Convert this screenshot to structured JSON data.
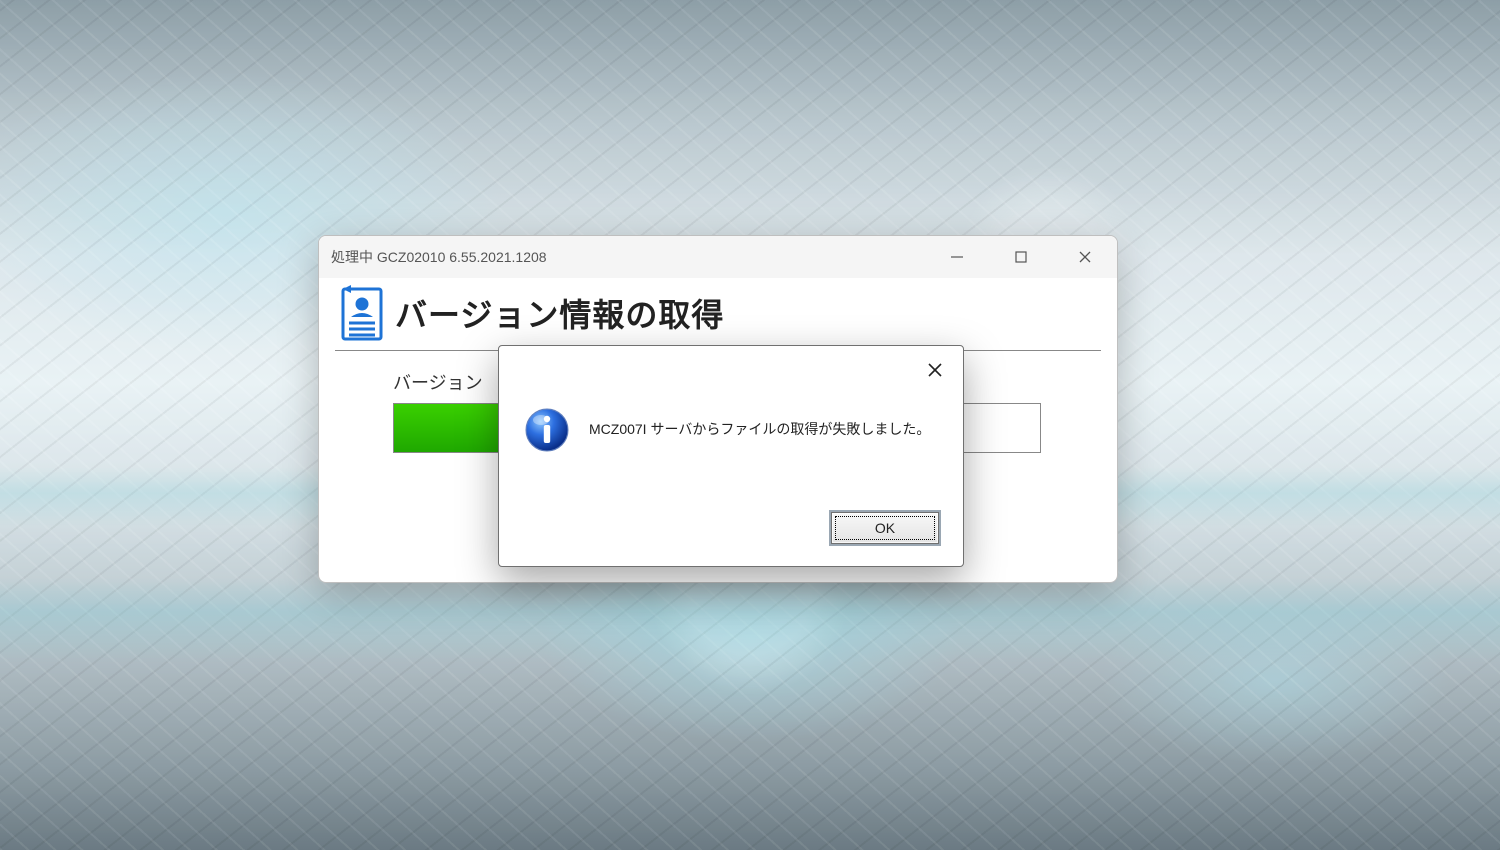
{
  "mainWindow": {
    "title": "処理中 GCZ02010  6.55.2021.1208",
    "heading": "バージョン情報の取得",
    "statusLabel": "バージョン",
    "progressPercent": 17
  },
  "messageBox": {
    "text": "MCZ007I サーバからファイルの取得が失敗しました。",
    "okLabel": "OK"
  }
}
